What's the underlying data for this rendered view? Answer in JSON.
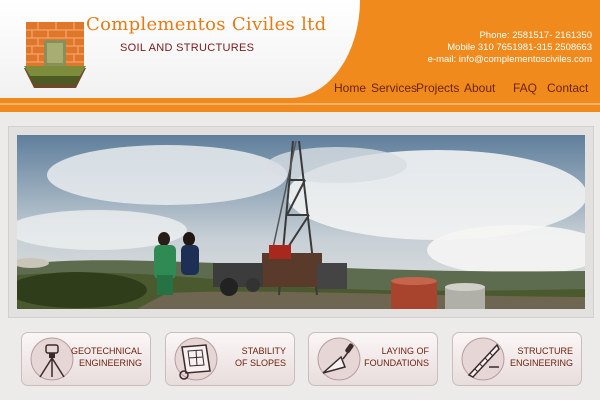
{
  "header": {
    "company_name": "Complementos Civiles ltd",
    "tagline": "SOIL AND STRUCTURES",
    "phone": "Phone: 2581517- 2161350",
    "mobile": "Mobile 310 7651981-315 2508663",
    "email": "e-mail: info@complementosciviles.com"
  },
  "nav": {
    "items": [
      {
        "label": "Home"
      },
      {
        "label": "Services"
      },
      {
        "label": "Projects"
      },
      {
        "label": "About"
      },
      {
        "label": "FAQ"
      },
      {
        "label": "Contact"
      }
    ]
  },
  "services": [
    {
      "line1": "GEOTECHNICAL",
      "line2": "ENGINEERING",
      "icon": "theodolite-icon"
    },
    {
      "line1": "STABILITY",
      "line2": "OF SLOPES",
      "icon": "blueprint-icon"
    },
    {
      "line1": "LAYING OF",
      "line2": "FOUNDATIONS",
      "icon": "trowel-icon"
    },
    {
      "line1": "STRUCTURE",
      "line2": "ENGINEERING",
      "icon": "ruler-icon"
    }
  ],
  "colors": {
    "accent": "#f08a1c",
    "nav_text": "#6b2406",
    "company_text": "#e67b14"
  }
}
